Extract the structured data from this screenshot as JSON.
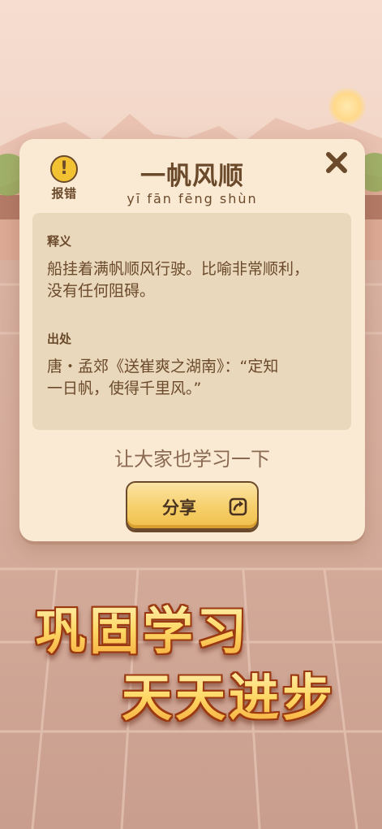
{
  "idiom": {
    "title": "一帆风顺",
    "pinyin": "yī fān fēng shùn"
  },
  "report": {
    "icon": "exclamation-circle-icon",
    "label": "报错"
  },
  "close": {
    "icon": "close-x-icon"
  },
  "meaning": {
    "label": "释义",
    "line1": "船挂着满帆顺风行驶。比喻非常顺利，",
    "line2": "没有任何阻碍。"
  },
  "source": {
    "label": "出处",
    "line1": "唐・孟郊《送崔爽之湖南》：“定知",
    "line2": "一日帆，使得千里风。”"
  },
  "share": {
    "hint": "让大家也学习一下",
    "button_label": "分享",
    "icon": "share-arrow-icon"
  },
  "promo": {
    "line1": "巩固学习",
    "line2": "天天进步"
  },
  "colors": {
    "dialog_bg": "#fbead3",
    "panel_bg": "#ead8bd",
    "text_brown": "#6b4a2b",
    "button_gold": "#f6cf6a"
  }
}
